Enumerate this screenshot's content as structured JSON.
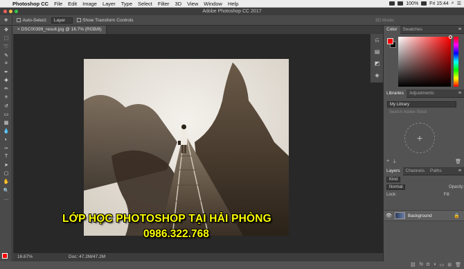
{
  "menubar": {
    "apple": "",
    "items": [
      "Photoshop CC",
      "File",
      "Edit",
      "Image",
      "Layer",
      "Type",
      "Select",
      "Filter",
      "3D",
      "View",
      "Window",
      "Help"
    ],
    "status": {
      "battery": "100%",
      "time": "Fri 15:44"
    }
  },
  "titlebar": {
    "title": "Adobe Photoshop CC 2017"
  },
  "options": {
    "auto_select_label": "Auto-Select:",
    "auto_select_value": "Layer",
    "transform_label": "Show Transform Controls",
    "mode3d_label": "3D Mode:"
  },
  "document": {
    "tab_label": "DSC00399_result.jpg @ 16.7% (RGB/8)",
    "zoom": "16.67%",
    "doc_size": "Doc: 47.2M/47.2M"
  },
  "overlay": {
    "title": "LỚP HỌC PHOTOSHOP TẠI HẢI PHÒNG",
    "phone": "0986.322.768"
  },
  "panels": {
    "color_tabs": [
      "Color",
      "Swatches"
    ],
    "library_tabs": [
      "Libraries",
      "Adjustments"
    ],
    "library_select": "My Library",
    "library_search": "Search Adobe Stock",
    "layer_tabs": [
      "Layers",
      "Channels",
      "Paths"
    ],
    "kind_label": "Kind",
    "blend_mode": "Normal",
    "opacity_label": "Opacity:",
    "lock_label": "Lock:",
    "fill_label": "Fill:",
    "layer_name": "Background"
  },
  "colors": {
    "foreground": "#ff0000",
    "background": "#000000",
    "overlay_text": "#ffff00"
  },
  "toolbar_icons": [
    "move-icon",
    "marquee-icon",
    "lasso-icon",
    "quick-select-icon",
    "crop-icon",
    "eyedropper-icon",
    "healing-icon",
    "brush-icon",
    "stamp-icon",
    "history-brush-icon",
    "eraser-icon",
    "gradient-icon",
    "blur-icon",
    "dodge-icon",
    "pen-icon",
    "type-icon",
    "path-select-icon",
    "shape-icon",
    "hand-icon",
    "zoom-icon",
    "more-icon"
  ]
}
